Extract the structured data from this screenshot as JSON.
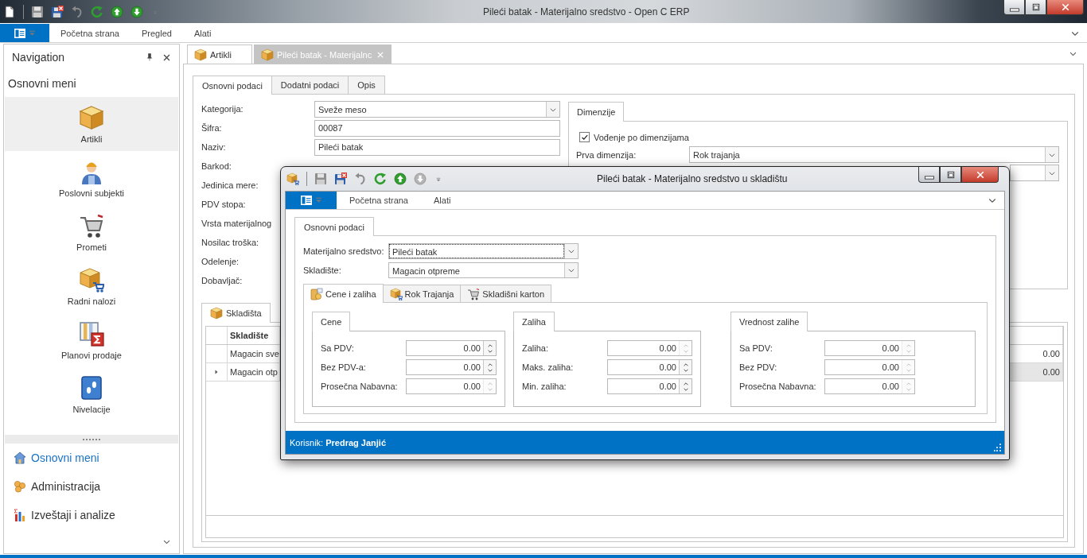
{
  "window": {
    "title": "Pileći batak - Materijalno sredstvo - Open C ERP"
  },
  "ribbon": {
    "tabs": [
      "Početna strana",
      "Pregled",
      "Alati"
    ]
  },
  "navigation": {
    "title": "Navigation",
    "menu_title": "Osnovni meni",
    "items": [
      {
        "label": "Artikli",
        "selected": true
      },
      {
        "label": "Poslovni subjekti",
        "selected": false
      },
      {
        "label": "Prometi",
        "selected": false
      },
      {
        "label": "Radni nalozi",
        "selected": false
      },
      {
        "label": "Planovi prodaje",
        "selected": false
      },
      {
        "label": "Nivelacije",
        "selected": false
      }
    ],
    "groups": [
      {
        "label": "Osnovni meni",
        "selected": true
      },
      {
        "label": "Administracija",
        "selected": false
      },
      {
        "label": "Izveštaji i analize",
        "selected": false
      }
    ]
  },
  "document_tabs": [
    {
      "label": "Artikli",
      "selected": false
    },
    {
      "label": "Pileći batak - Materijalnc",
      "selected": true
    }
  ],
  "form": {
    "tabs": [
      {
        "label": "Osnovni podaci",
        "selected": true
      },
      {
        "label": "Dodatni podaci",
        "selected": false
      },
      {
        "label": "Opis",
        "selected": false
      }
    ],
    "fields": [
      {
        "label": "Kategorija:",
        "kind": "combo",
        "value": "Sveže meso"
      },
      {
        "label": "Šifra:",
        "kind": "text",
        "value": "00087"
      },
      {
        "label": "Naziv:",
        "kind": "text",
        "value": "Pileći batak"
      },
      {
        "label": "Barkod:"
      },
      {
        "label": "Jedinica mere:"
      },
      {
        "label": "PDV stopa:"
      },
      {
        "label": "Vrsta materijalnog"
      },
      {
        "label": "Nosilac troška:"
      },
      {
        "label": "Odelenje:"
      },
      {
        "label": "Dobavljač:"
      }
    ]
  },
  "dimensions": {
    "tab": "Dimenzije",
    "tracking": {
      "label": "Vođenje po dimenzijama",
      "checked": true
    },
    "fields": [
      {
        "label": "Prva dimenzija:",
        "kind": "combo",
        "value": "Rok trajanja"
      },
      {
        "kind": "combo"
      }
    ]
  },
  "stock": {
    "tab": "Skladišta",
    "column": "Skladište",
    "rows": [
      {
        "name": "Magacin sve",
        "amount": "0.00",
        "selected": false
      },
      {
        "name": "Magacin otp",
        "amount": "0.00",
        "selected": true
      }
    ]
  },
  "dialog": {
    "title": "Pileći batak - Materijalno sredstvo u skladištu",
    "ribbon_tabs": [
      "Početna strana",
      "Alati"
    ],
    "tabs": [
      {
        "label": "Osnovni podaci",
        "selected": true
      }
    ],
    "fields": [
      {
        "label": "Materijalno sredstvo:",
        "value": "Pileći batak",
        "focused": true
      },
      {
        "label": "Skladište:",
        "value": "Magacin otpreme",
        "focused": false
      }
    ],
    "subtabs": [
      {
        "label": "Cene i zaliha",
        "selected": true
      },
      {
        "label": "Rok Trajanja",
        "selected": false
      },
      {
        "label": "Skladišni karton",
        "selected": false
      }
    ],
    "groups": [
      {
        "title": "Cene",
        "fields": [
          {
            "label": "Sa PDV:",
            "value": "0.00",
            "disabled": false
          },
          {
            "label": "Bez PDV-a:",
            "value": "0.00",
            "disabled": false
          },
          {
            "label": "Prosečna Nabavna:",
            "value": "0.00",
            "disabled": true
          }
        ]
      },
      {
        "title": "Zaliha",
        "fields": [
          {
            "label": "Zaliha:",
            "value": "0.00",
            "disabled": true
          },
          {
            "label": "Maks. zaliha:",
            "value": "0.00",
            "disabled": false
          },
          {
            "label": "Min. zaliha:",
            "value": "0.00",
            "disabled": false
          }
        ]
      },
      {
        "title": "Vrednost zalihe",
        "fields": [
          {
            "label": "Sa PDV:",
            "value": "0.00",
            "disabled": true
          },
          {
            "label": "Bez PDV:",
            "value": "0.00",
            "disabled": true
          },
          {
            "label": "Prosečna Nabavna:",
            "value": "0.00",
            "disabled": true
          }
        ]
      }
    ],
    "status": {
      "label": "Korisnik:",
      "user": "Predrag Janjić"
    }
  }
}
